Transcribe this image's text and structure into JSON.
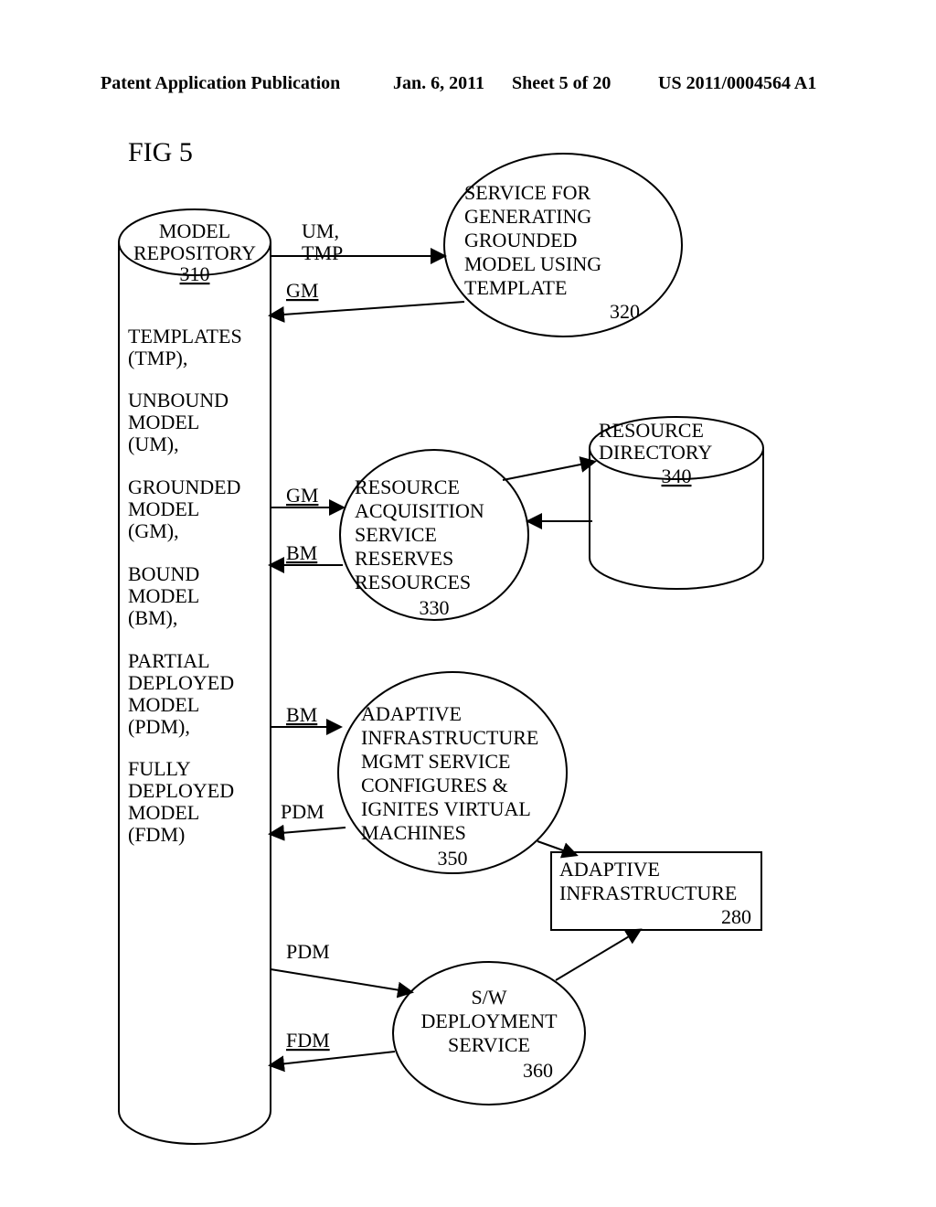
{
  "header": {
    "left": "Patent Application Publication",
    "center": "Jan. 6, 2011",
    "sheet": "Sheet 5 of 20",
    "right": "US 2011/0004564 A1"
  },
  "figure_label": "FIG 5",
  "repo": {
    "title": "MODEL REPOSITORY",
    "num": "310",
    "items": [
      "TEMPLATES (TMP),",
      "UNBOUND MODEL (UM),",
      "GROUNDED MODEL (GM),",
      "BOUND MODEL (BM),",
      "PARTIAL DEPLOYED MODEL (PDM),",
      "FULLY DEPLOYED MODEL (FDM)"
    ]
  },
  "svc320": {
    "l1": "SERVICE FOR",
    "l2": "GENERATING",
    "l3": "GROUNDED",
    "l4": "MODEL USING",
    "l5": "TEMPLATE",
    "num": "320"
  },
  "svc330": {
    "l1": "RESOURCE",
    "l2": "ACQUISITION",
    "l3": "SERVICE",
    "l4": "RESERVES",
    "l5": "RESOURCES",
    "num": "330"
  },
  "svc350": {
    "l1": "ADAPTIVE",
    "l2": "INFRASTRUCTURE",
    "l3": "MGMT SERVICE",
    "l4": "CONFIGURES &",
    "l5": "IGNITES VIRTUAL",
    "l6": "MACHINES",
    "num": "350"
  },
  "svc360": {
    "l1": "S/W",
    "l2": "DEPLOYMENT",
    "l3": "SERVICE",
    "num": "360"
  },
  "dir340": {
    "l1": "RESOURCE",
    "l2": "DIRECTORY",
    "num": "340"
  },
  "box280": {
    "l1": "ADAPTIVE",
    "l2": "INFRASTRUCTURE",
    "num": "280"
  },
  "labels": {
    "um_tmp_1": "UM,",
    "um_tmp_2": "TMP",
    "gm1": "GM",
    "gm2": "GM",
    "bm1": "BM",
    "bm2": "BM",
    "pdm1": "PDM",
    "pdm2": "PDM",
    "fdm": "FDM"
  }
}
